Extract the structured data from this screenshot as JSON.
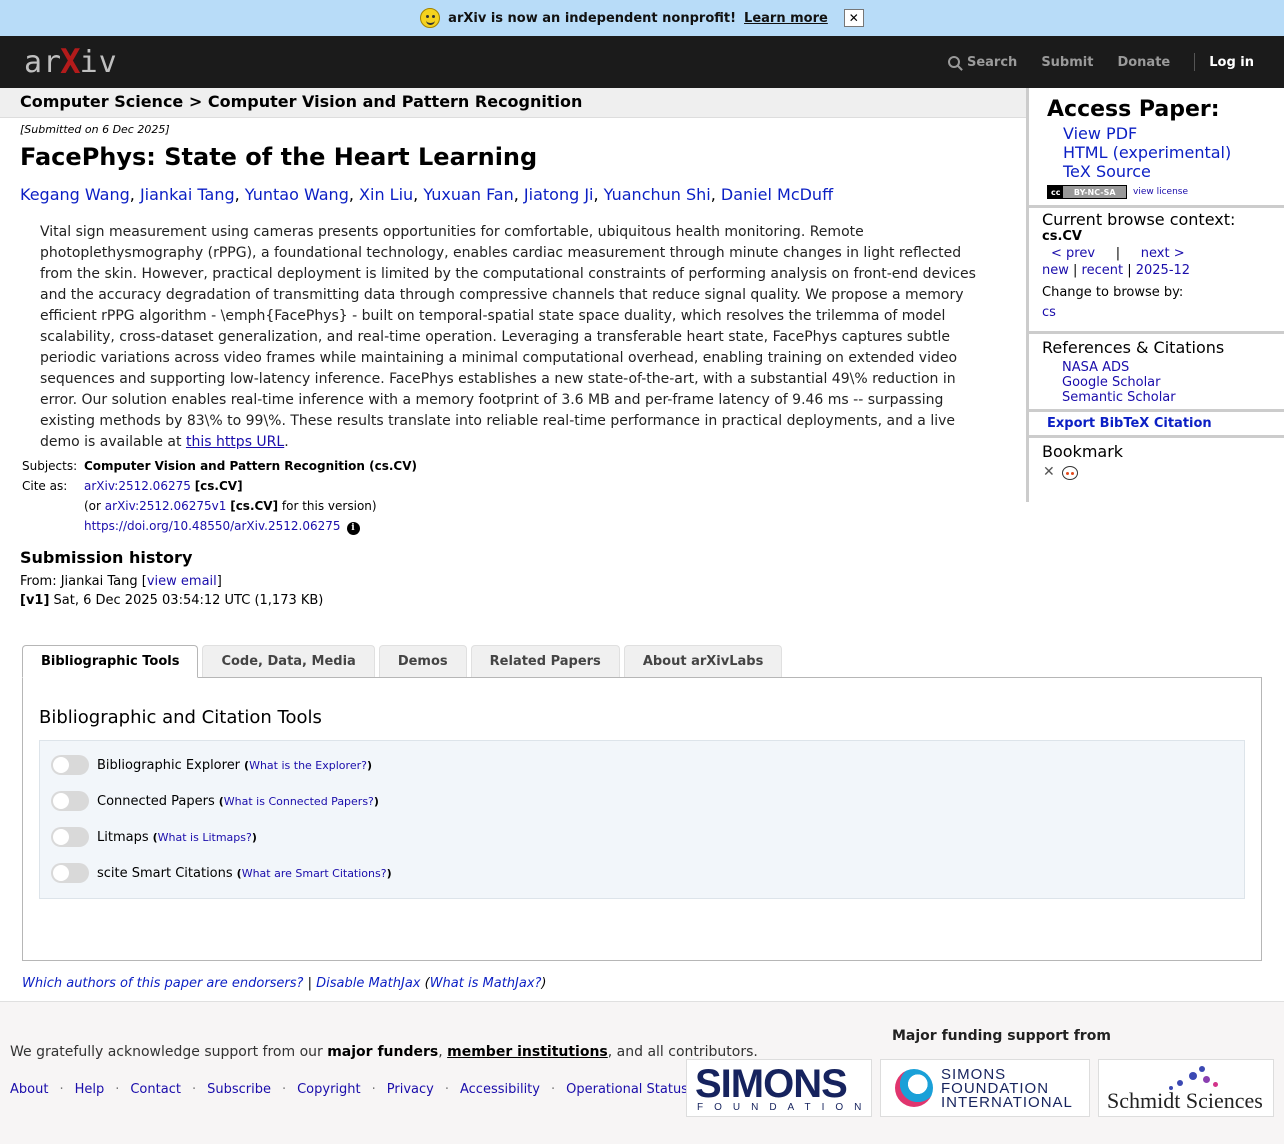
{
  "banner": {
    "message": "arXiv is now an independent nonprofit!",
    "learn_more": "Learn more",
    "close": "✕"
  },
  "header": {
    "logo_a": "ar",
    "logo_x": "X",
    "logo_b": "iv",
    "nav": {
      "search": "Search",
      "submit": "Submit",
      "donate": "Donate",
      "login": "Log in"
    }
  },
  "breadcrumb": "Computer Science > Computer Vision and Pattern Recognition",
  "paper": {
    "submitted": "[Submitted on 6 Dec 2025]",
    "title": "FacePhys: State of the Heart Learning",
    "authors": [
      "Kegang Wang",
      "Jiankai Tang",
      "Yuntao Wang",
      "Xin Liu",
      "Yuxuan Fan",
      "Jiatong Ji",
      "Yuanchun Shi",
      "Daniel McDuff"
    ],
    "author_sep": ", ",
    "abstract": "Vital sign measurement using cameras presents opportunities for comfortable, ubiquitous health monitoring. Remote photoplethysmography (rPPG), a foundational technology, enables cardiac measurement through minute changes in light reflected from the skin. However, practical deployment is limited by the computational constraints of performing analysis on front-end devices and the accuracy degradation of transmitting data through compressive channels that reduce signal quality. We propose a memory efficient rPPG algorithm - \\emph{FacePhys} - built on temporal-spatial state space duality, which resolves the trilemma of model scalability, cross-dataset generalization, and real-time operation. Leveraging a transferable heart state, FacePhys captures subtle periodic variations across video frames while maintaining a minimal computational overhead, enabling training on extended video sequences and supporting low-latency inference. FacePhys establishes a new state-of-the-art, with a substantial 49\\% reduction in error. Our solution enables real-time inference with a memory footprint of 3.6 MB and per-frame latency of 9.46 ms -- surpassing existing methods by 83\\% to 99\\%. These results translate into reliable real-time performance in practical deployments, and a live demo is available at ",
    "abstract_link": "this https URL",
    "abstract_end": "."
  },
  "meta": {
    "subjects_label": "Subjects:",
    "subjects_value": "Computer Vision and Pattern Recognition (cs.CV)",
    "cite_label": "Cite as:",
    "cite_id": "arXiv:2512.06275",
    "cite_cat": "[cs.CV]",
    "version_pre": "(or ",
    "version_id": "arXiv:2512.06275v1",
    "version_cat": "[cs.CV]",
    "version_post": " for this version)",
    "doi": "https://doi.org/10.48550/arXiv.2512.06275",
    "info_icon": "i"
  },
  "history": {
    "title": "Submission history",
    "from_pre": "From: Jiankai Tang [",
    "view_email": "view email",
    "from_post": "]",
    "version": "[v1]",
    "version_date": " Sat, 6 Dec 2025 03:54:12 UTC (1,173 KB)"
  },
  "tabs": [
    {
      "label": "Bibliographic Tools",
      "active": true
    },
    {
      "label": "Code, Data, Media"
    },
    {
      "label": "Demos"
    },
    {
      "label": "Related Papers"
    },
    {
      "label": "About arXivLabs"
    }
  ],
  "tools": {
    "title": "Bibliographic and Citation Tools",
    "items": [
      {
        "label": "Bibliographic Explorer",
        "help": "What is the Explorer?"
      },
      {
        "label": "Connected Papers",
        "help": "What is Connected Papers?"
      },
      {
        "label": "Litmaps",
        "help": "What is Litmaps?"
      },
      {
        "label": "scite Smart Citations",
        "help": "What are Smart Citations?"
      }
    ]
  },
  "endorse": {
    "endorsers": "Which authors of this paper are endorsers?",
    "sep": " | ",
    "mathjax": "Disable MathJax",
    "open": " (",
    "what_mathjax": "What is MathJax?",
    "close": ")"
  },
  "sidebar": {
    "access_title": "Access Paper:",
    "links": [
      "View PDF",
      "HTML (experimental)",
      "TeX Source"
    ],
    "license_badge_c": "cc",
    "license_badge_t": "BY-NC-SA",
    "view_license": "view license",
    "context_title": "Current browse context:",
    "context_cat": "cs.CV",
    "prev": "< prev",
    "nav_sep": "|",
    "next": "next >",
    "new": "new",
    "recent": "recent",
    "month": "2025-12",
    "bar": " | ",
    "change_browse": "Change to browse by:",
    "browse_cs": "cs",
    "refs_title": "References & Citations",
    "refs": [
      "NASA ADS",
      "Google Scholar",
      "Semantic Scholar"
    ],
    "bibtex": "Export BibTeX Citation",
    "bookmark_title": "Bookmark"
  },
  "footer": {
    "ack_pre": "We gratefully acknowledge support from our ",
    "major_funders": "major funders",
    "comma": ", ",
    "member_institutions": "member institutions",
    "ack_post": ", and all contributors.",
    "links": [
      "About",
      "Help",
      "Contact",
      "Subscribe",
      "Copyright",
      "Privacy",
      "Accessibility",
      "Operational Status"
    ],
    "dot": "·",
    "funding_title": "Major funding support from",
    "simons_big": "SIMONS",
    "simons_small": "FOUNDATION",
    "sfi_text": [
      "SIMONS",
      "FOUNDATION",
      "INTERNATIONAL"
    ],
    "schmidt": "Schmidt Sciences"
  }
}
